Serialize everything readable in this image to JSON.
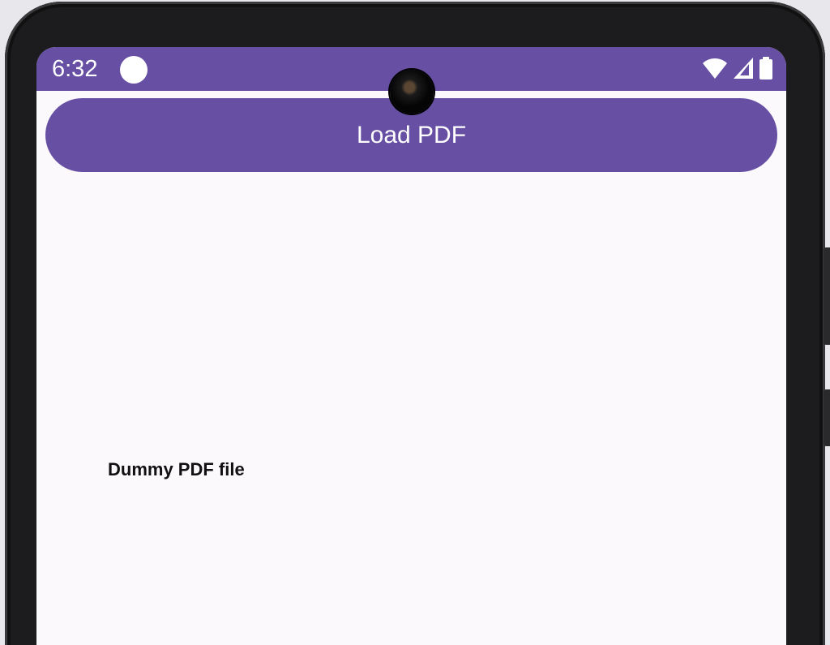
{
  "status_bar": {
    "time": "6:32",
    "icons": [
      "notification-dot-icon",
      "wifi-icon",
      "signal-icon",
      "battery-icon"
    ]
  },
  "main": {
    "load_button_label": "Load PDF"
  },
  "pdf_viewer": {
    "document_text": "Dummy PDF file"
  },
  "colors": {
    "primary": "#6750a4",
    "surface": "#fcf9fd",
    "on_primary": "#ffffff",
    "text": "#111111"
  }
}
